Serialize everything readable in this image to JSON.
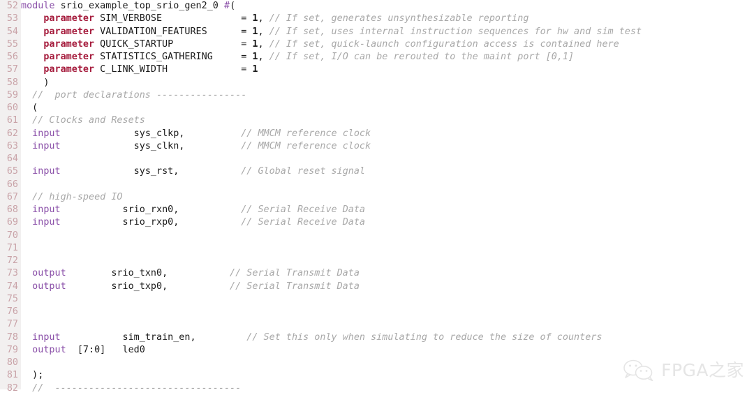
{
  "editor": {
    "language": "verilog",
    "first_line_number": 52,
    "colors": {
      "background": "#ffffff",
      "gutter_background": "#f2f0f0",
      "line_number": "#c9a3a8",
      "keyword": "#8a4fa8",
      "parameter_keyword": "#a51b3c",
      "comment": "#a8a8a8",
      "identifier": "#1a1a1a"
    }
  },
  "watermark": {
    "icon": "wechat-icon",
    "text": "FPGA之家",
    "color": "#c2c2c2"
  },
  "lines": [
    {
      "n": "52",
      "tokens": [
        {
          "t": "kw",
          "s": "module"
        },
        {
          "t": "plain",
          "s": " srio_example_top_srio_gen2_0 "
        },
        {
          "t": "kw",
          "s": "#"
        },
        {
          "t": "plain",
          "s": "("
        }
      ]
    },
    {
      "n": "53",
      "tokens": [
        {
          "t": "plain",
          "s": "    "
        },
        {
          "t": "param",
          "s": "parameter"
        },
        {
          "t": "plain",
          "s": " SIM_VERBOSE              = "
        },
        {
          "t": "num",
          "s": "1"
        },
        {
          "t": "plain",
          "s": ", "
        },
        {
          "t": "cmt",
          "s": "// If set, generates unsynthesizable reporting"
        }
      ]
    },
    {
      "n": "54",
      "tokens": [
        {
          "t": "plain",
          "s": "    "
        },
        {
          "t": "param",
          "s": "parameter"
        },
        {
          "t": "plain",
          "s": " VALIDATION_FEATURES      = "
        },
        {
          "t": "num",
          "s": "1"
        },
        {
          "t": "plain",
          "s": ", "
        },
        {
          "t": "cmt",
          "s": "// If set, uses internal instruction sequences for hw and sim test"
        }
      ]
    },
    {
      "n": "55",
      "tokens": [
        {
          "t": "plain",
          "s": "    "
        },
        {
          "t": "param",
          "s": "parameter"
        },
        {
          "t": "plain",
          "s": " QUICK_STARTUP            = "
        },
        {
          "t": "num",
          "s": "1"
        },
        {
          "t": "plain",
          "s": ", "
        },
        {
          "t": "cmt",
          "s": "// If set, quick-launch configuration access is contained here"
        }
      ]
    },
    {
      "n": "56",
      "tokens": [
        {
          "t": "plain",
          "s": "    "
        },
        {
          "t": "param",
          "s": "parameter"
        },
        {
          "t": "plain",
          "s": " STATISTICS_GATHERING     = "
        },
        {
          "t": "num",
          "s": "1"
        },
        {
          "t": "plain",
          "s": ", "
        },
        {
          "t": "cmt",
          "s": "// If set, I/O can be rerouted to the maint port [0,1]"
        }
      ]
    },
    {
      "n": "57",
      "tokens": [
        {
          "t": "plain",
          "s": "    "
        },
        {
          "t": "param",
          "s": "parameter"
        },
        {
          "t": "plain",
          "s": " C_LINK_WIDTH             = "
        },
        {
          "t": "num",
          "s": "1"
        }
      ]
    },
    {
      "n": "58",
      "tokens": [
        {
          "t": "plain",
          "s": "    )"
        }
      ]
    },
    {
      "n": "59",
      "tokens": [
        {
          "t": "plain",
          "s": "  "
        },
        {
          "t": "cmt",
          "s": "//  port declarations ----------------"
        }
      ]
    },
    {
      "n": "60",
      "tokens": [
        {
          "t": "plain",
          "s": "  ("
        }
      ]
    },
    {
      "n": "61",
      "tokens": [
        {
          "t": "plain",
          "s": "  "
        },
        {
          "t": "cmt",
          "s": "// Clocks and Resets"
        }
      ]
    },
    {
      "n": "62",
      "tokens": [
        {
          "t": "plain",
          "s": "  "
        },
        {
          "t": "kw",
          "s": "input"
        },
        {
          "t": "plain",
          "s": "             sys_clkp,          "
        },
        {
          "t": "cmt",
          "s": "// MMCM reference clock"
        }
      ]
    },
    {
      "n": "63",
      "tokens": [
        {
          "t": "plain",
          "s": "  "
        },
        {
          "t": "kw",
          "s": "input"
        },
        {
          "t": "plain",
          "s": "             sys_clkn,          "
        },
        {
          "t": "cmt",
          "s": "// MMCM reference clock"
        }
      ]
    },
    {
      "n": "64",
      "tokens": []
    },
    {
      "n": "65",
      "tokens": [
        {
          "t": "plain",
          "s": "  "
        },
        {
          "t": "kw",
          "s": "input"
        },
        {
          "t": "plain",
          "s": "             sys_rst,           "
        },
        {
          "t": "cmt",
          "s": "// Global reset signal"
        }
      ]
    },
    {
      "n": "66",
      "tokens": []
    },
    {
      "n": "67",
      "tokens": [
        {
          "t": "plain",
          "s": "  "
        },
        {
          "t": "cmt",
          "s": "// high-speed IO"
        }
      ]
    },
    {
      "n": "68",
      "tokens": [
        {
          "t": "plain",
          "s": "  "
        },
        {
          "t": "kw",
          "s": "input"
        },
        {
          "t": "plain",
          "s": "           srio_rxn0,           "
        },
        {
          "t": "cmt",
          "s": "// Serial Receive Data"
        }
      ]
    },
    {
      "n": "69",
      "tokens": [
        {
          "t": "plain",
          "s": "  "
        },
        {
          "t": "kw",
          "s": "input"
        },
        {
          "t": "plain",
          "s": "           srio_rxp0,           "
        },
        {
          "t": "cmt",
          "s": "// Serial Receive Data"
        }
      ]
    },
    {
      "n": "70",
      "tokens": []
    },
    {
      "n": "71",
      "tokens": []
    },
    {
      "n": "72",
      "tokens": []
    },
    {
      "n": "73",
      "tokens": [
        {
          "t": "plain",
          "s": "  "
        },
        {
          "t": "kw",
          "s": "output"
        },
        {
          "t": "plain",
          "s": "        srio_txn0,           "
        },
        {
          "t": "cmt",
          "s": "// Serial Transmit Data"
        }
      ]
    },
    {
      "n": "74",
      "tokens": [
        {
          "t": "plain",
          "s": "  "
        },
        {
          "t": "kw",
          "s": "output"
        },
        {
          "t": "plain",
          "s": "        srio_txp0,           "
        },
        {
          "t": "cmt",
          "s": "// Serial Transmit Data"
        }
      ]
    },
    {
      "n": "75",
      "tokens": []
    },
    {
      "n": "76",
      "tokens": []
    },
    {
      "n": "77",
      "tokens": []
    },
    {
      "n": "78",
      "tokens": [
        {
          "t": "plain",
          "s": "  "
        },
        {
          "t": "kw",
          "s": "input"
        },
        {
          "t": "plain",
          "s": "           sim_train_en,         "
        },
        {
          "t": "cmt",
          "s": "// Set this only when simulating to reduce the size of counters"
        }
      ]
    },
    {
      "n": "79",
      "tokens": [
        {
          "t": "plain",
          "s": "  "
        },
        {
          "t": "kw",
          "s": "output"
        },
        {
          "t": "plain",
          "s": "  [7:0]   led0"
        }
      ]
    },
    {
      "n": "80",
      "tokens": []
    },
    {
      "n": "81",
      "tokens": [
        {
          "t": "plain",
          "s": "  );"
        }
      ]
    },
    {
      "n": "82",
      "tokens": [
        {
          "t": "plain",
          "s": "  "
        },
        {
          "t": "cmt",
          "s": "//  ---------------------------------"
        }
      ]
    }
  ]
}
